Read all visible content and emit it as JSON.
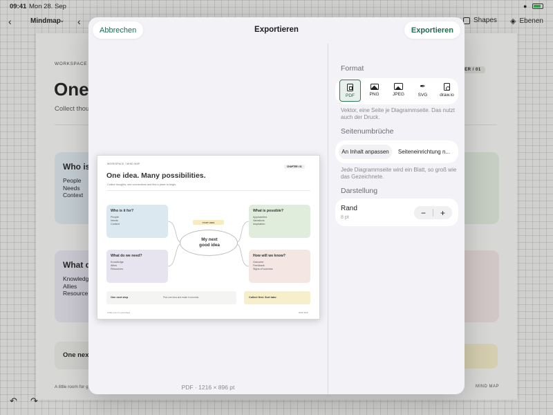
{
  "statusbar": {
    "time": "09:41",
    "date": "Mon 28. Sep"
  },
  "toolbar": {
    "doc_title": "Mindmap",
    "shapes_label": "Shapes",
    "layers_label": "Ebenen"
  },
  "canvas_doc": {
    "breadcrumb": "WORKSPACE /",
    "title": "One",
    "subtitle": "Collect thou",
    "chapter": "TER / 01",
    "card1_title": "Who is",
    "card1_items": [
      "People",
      "Needs",
      "Context"
    ],
    "card2_title": "What d",
    "card2_items": [
      "Knowledg",
      "Allies",
      "Resource"
    ],
    "next_step": "One nex",
    "footer_left": "A little room for g",
    "footer_right": "MIND MAP"
  },
  "modal": {
    "cancel_label": "Abbrechen",
    "title": "Exportieren",
    "export_label": "Exportieren"
  },
  "preview": {
    "breadcrumb": "WORKSPACE / MIND MAP",
    "badge": "CHAPTER / 01",
    "title": "One idea. Many possibilities.",
    "subtitle": "Collect thoughts, see connections and find a place to begin.",
    "start_here": "START HERE",
    "center_line1": "My next",
    "center_line2": "good idea",
    "card1": {
      "title": "Who is it for?",
      "items": [
        "People",
        "Needs",
        "Context"
      ]
    },
    "card2": {
      "title": "What do we need?",
      "items": [
        "Knowledge",
        "Allies",
        "Resources"
      ]
    },
    "card3": {
      "title": "What is possible?",
      "items": [
        "Approaches",
        "Variations",
        "Inspiration"
      ]
    },
    "card4": {
      "title": "How will we know?",
      "items": [
        "Outcome",
        "Feedback",
        "Signs of success"
      ]
    },
    "next_step_title": "One next step",
    "next_step_text": "Pick one idea and make it concrete.",
    "yellow_text": "Collect first. Sort later.",
    "footer_left": "A little room for good ideas",
    "footer_right": "MIND MAP",
    "caption": "PDF · 1216 × 896 pt"
  },
  "settings": {
    "format_label": "Format",
    "formats": [
      {
        "label": "PDF",
        "icon": "pdf-icon",
        "selected": true
      },
      {
        "label": "PNG",
        "icon": "image-icon",
        "selected": false
      },
      {
        "label": "JPEG",
        "icon": "images-icon",
        "selected": false
      },
      {
        "label": "SVG",
        "icon": "pen-icon",
        "selected": false
      },
      {
        "label": "draw.io",
        "icon": "drawio-file-icon",
        "selected": false
      }
    ],
    "format_description": "Vektor, eine Seite je Diagrammseite. Das nutzt auch der Druck.",
    "pagebreaks_label": "Seitenumbrüche",
    "pagebreak_options": [
      "An Inhalt anpassen",
      "Seiteneinrichtung n..."
    ],
    "pagebreak_selected": "An Inhalt anpassen",
    "pagebreak_description": "Jede Diagrammseite wird ein Blatt, so groß wie das Gezeichnete.",
    "display_label": "Darstellung",
    "margin_label": "Rand",
    "margin_value": "8 pt",
    "minus": "−",
    "plus": "+"
  },
  "colors": {
    "accent": "#1f6b4e",
    "selected_bg": "#e7f0eb",
    "sheet_bg": "#f2f2f7"
  }
}
